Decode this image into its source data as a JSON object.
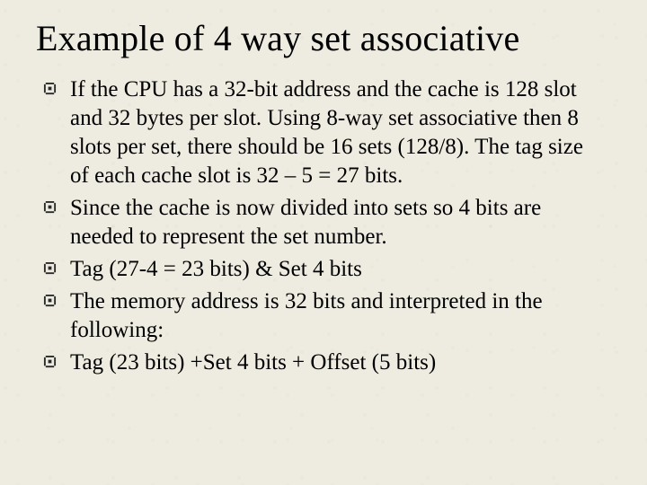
{
  "title": "Example of 4 way set associative",
  "bullets": [
    "If the CPU has a 32-bit address and the cache is 128 slot and 32 bytes per slot. Using 8-way set associative then 8 slots per set, there should be 16 sets (128/8). The tag size of each cache slot is 32 – 5 = 27 bits.",
    "Since the cache is now divided into sets so 4 bits are needed to represent the set number.",
    "Tag (27-4 = 23 bits) & Set 4 bits",
    "The memory address is 32 bits and interpreted in the following:",
    "Tag (23 bits) +Set 4 bits + Offset (5 bits)"
  ]
}
